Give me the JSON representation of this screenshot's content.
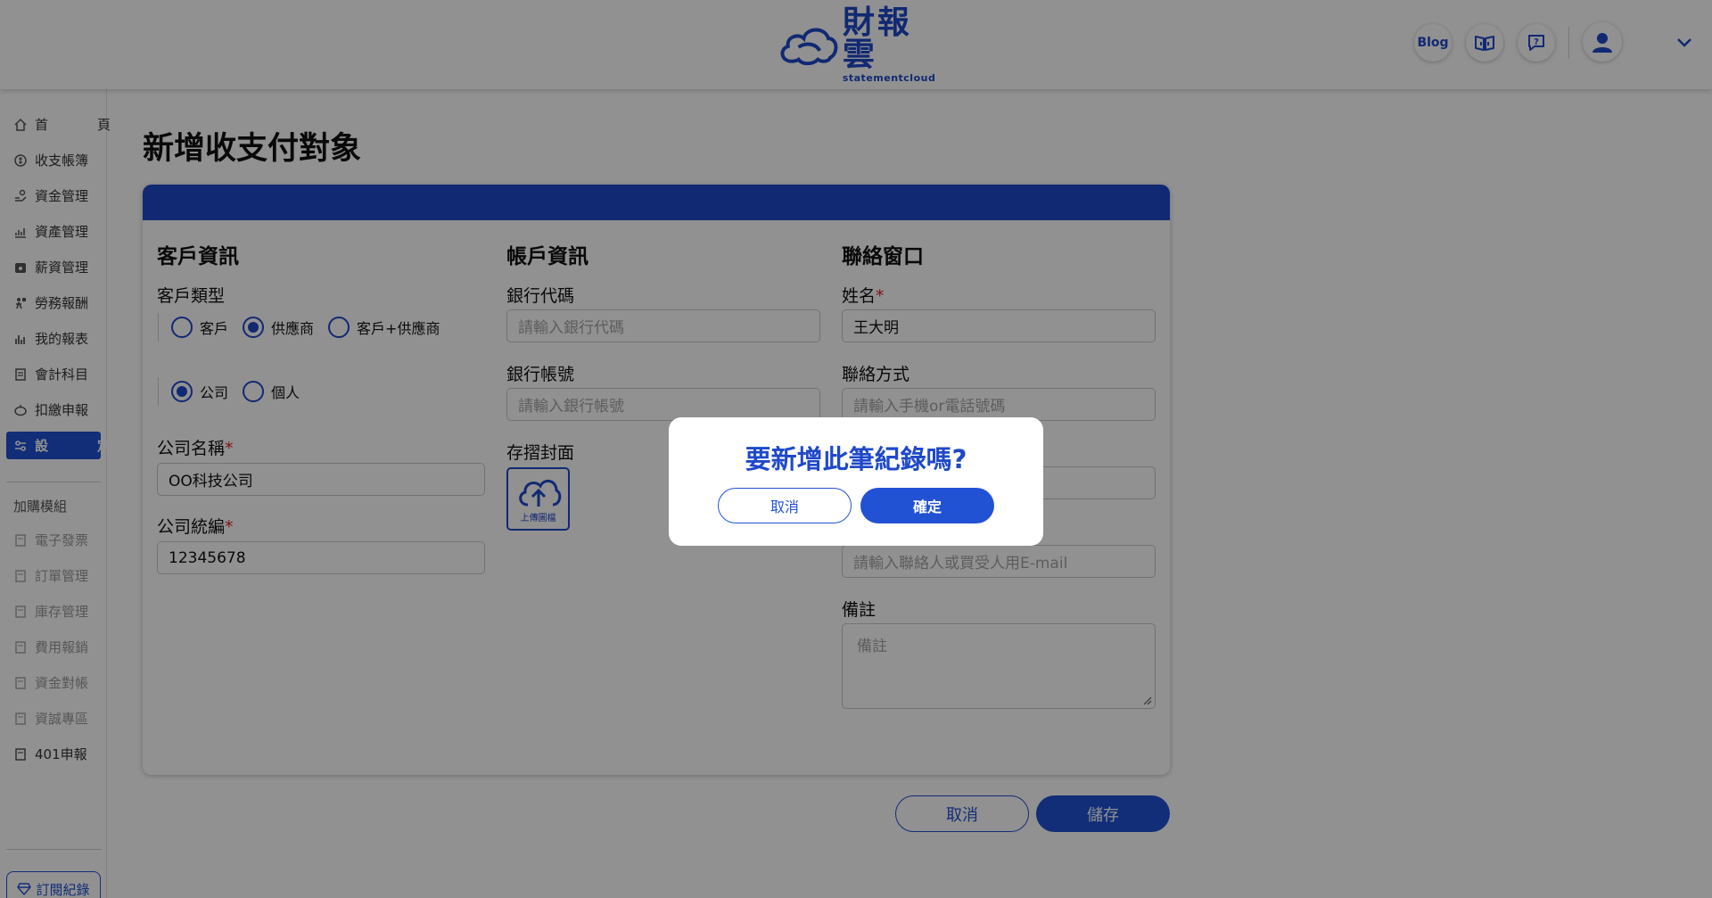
{
  "header": {
    "logo_title": "財報雲",
    "logo_subtitle": "statementcloud",
    "blog_label": "Blog"
  },
  "sidebar": {
    "items": [
      {
        "label": "首　頁"
      },
      {
        "label": "收支帳簿"
      },
      {
        "label": "資金管理"
      },
      {
        "label": "資產管理"
      },
      {
        "label": "薪資管理"
      },
      {
        "label": "勞務報酬"
      },
      {
        "label": "我的報表"
      },
      {
        "label": "會計科目"
      },
      {
        "label": "扣繳申報"
      },
      {
        "label": "設　定"
      }
    ],
    "addon_title": "加購模組",
    "addons": [
      {
        "label": "電子發票"
      },
      {
        "label": "訂單管理"
      },
      {
        "label": "庫存管理"
      },
      {
        "label": "費用報銷"
      },
      {
        "label": "資金對帳"
      },
      {
        "label": "資誠專區"
      },
      {
        "label": "401申報"
      }
    ],
    "subscription_label": "訂閱紀錄"
  },
  "page": {
    "title": "新增收支付對象"
  },
  "form": {
    "customer": {
      "section_title": "客戶資訊",
      "type_label": "客戶類型",
      "type_options": [
        "客戶",
        "供應商",
        "客戶+供應商"
      ],
      "type_selected": "供應商",
      "entity_options": [
        "公司",
        "個人"
      ],
      "entity_selected": "公司",
      "company_name_label": "公司名稱",
      "company_name_value": "OO科技公司",
      "tax_id_label": "公司統編",
      "tax_id_value": "12345678"
    },
    "account": {
      "section_title": "帳戶資訊",
      "bank_code_label": "銀行代碼",
      "bank_code_placeholder": "請輸入銀行代碼",
      "bank_account_label": "銀行帳號",
      "bank_account_placeholder": "請輸入銀行帳號",
      "cover_label": "存摺封面",
      "upload_label": "上傳圖檔"
    },
    "contact": {
      "section_title": "聯絡窗口",
      "name_label": "姓名",
      "name_value": "王大明",
      "method_label": "聯絡方式",
      "method_placeholder": "請輸入手機or電話號碼",
      "email_placeholder": "請輸入聯絡人或買受人用E-mail",
      "note_label": "備註",
      "note_placeholder": "備註"
    },
    "required_mark": "*"
  },
  "actions": {
    "cancel_label": "取消",
    "save_label": "儲存"
  },
  "modal": {
    "title": "要新增此筆紀錄嗎?",
    "cancel_label": "取消",
    "confirm_label": "確定"
  },
  "colors": {
    "primary": "#1f49c9",
    "active_nav": "#2152d4",
    "required": "#e0242c"
  }
}
